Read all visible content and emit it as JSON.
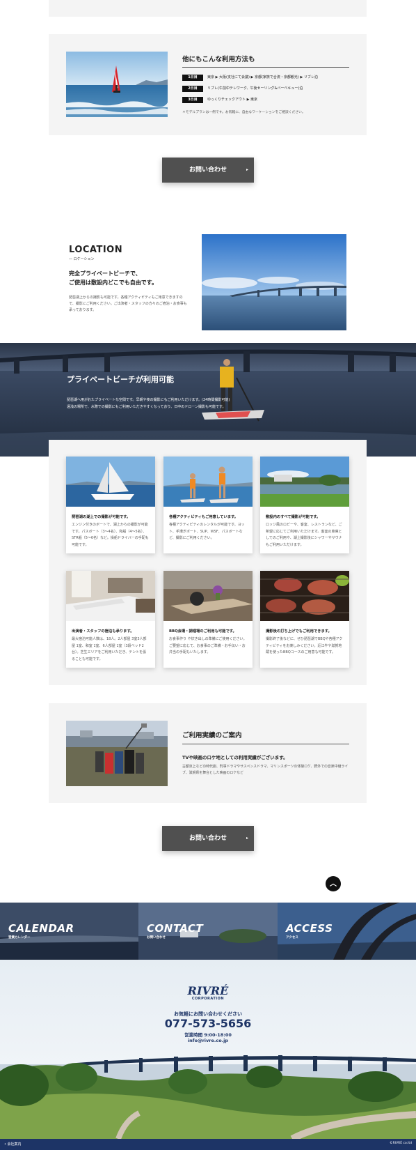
{
  "usage_box": {
    "title": "他にもこんな利用方法も",
    "days": [
      {
        "tag": "1日目",
        "text": "東京 ▶ 大阪(支社にて会議) ▶ 京都(家族で合流・京都観光) ▶ リブレ泊"
      },
      {
        "tag": "2日目",
        "text": "リブレ(午前中テレワーク、午後セーリング&バーベキュー)泊"
      },
      {
        "tag": "3日目",
        "text": "ゆっくりチェックアウト ▶ 東京"
      }
    ],
    "note": "＊モデルプランは一例です。お気軽に、自由なワーケーションをご相談ください。"
  },
  "cta": {
    "label": "お問い合わせ",
    "arrow": "▸"
  },
  "location": {
    "heading": "LOCATION",
    "subheading": "― ロケーション",
    "lead_line1": "完全プライベートビーチで、",
    "lead_line2": "ご使用は敷設内どこでも自由です。",
    "body": "琵琶湖上からの撮影も可能です。各種アクティビティもご用意できますので、撮影にご利用ください。ご出演者・スタッフの方々のご宿泊・お食事も承っております。"
  },
  "banner": {
    "title": "プライベートビーチが利用可能",
    "line1": "琵琶湖へ用がおたプライベートな空間です。早朝や夜の撮影にもご利用いただけます。(24時間撮影可能)",
    "line2": "遠浅の場所で、水際での撮影にもご利用いただきやすくなっており、日中のドローン撮影も可能です。"
  },
  "features": [
    {
      "title": "琵琶湖の湖上での撮影が可能です。",
      "text": "エンジン付きのボートで、湖上からの撮影が可能です。パスボート（3〜4名）、和船（4〜5名）、STR船（5〜6名）など。操船ドライバーの手配も可能です。"
    },
    {
      "title": "各種アクティビティもご用意しています。",
      "text": "各種アクティビティのレンタルが可能です。ヨット、手漕ぎボート、SUP、WSF、パスボートなど、撮影にご利用ください。"
    },
    {
      "title": "敷設内のすべて撮影が可能です。",
      "text": "ロッジ風のロビーや、客室、レストランなど、ご希望に応じてご利用いただけます。客室の車庫としてのご利用や、湖上撮影後にシャワーやサウナもご利用いただけます。"
    },
    {
      "title": "出演者・スタッフの宿泊も承ります。",
      "text": "最大宿泊可能人数は、18人。2人部屋 3室3人部屋 1室、和室 1室、6人部屋 1室（3段ベッド2台）。芝生エリアをご利用いただき、テントを張ることも可能です。"
    },
    {
      "title": "BBQ会場・調理場のご利用も可能です。",
      "text": "お食事作り や炊き出しの準備にご使用ください。ご要望に応じて、お食事のご準備・お手伝い・お弁当の手配もいたします。"
    },
    {
      "title": "撮影後の打ち上げでもご利用できます。",
      "text": "撮影終了後などに、ぜひ琵琶湖でBBQや各種アクティビティをお楽しみください。近江牛や滋賀地蔵を使ったBBQコースのご用意も可能です。"
    }
  ],
  "record": {
    "title": "ご利用実績のご案内",
    "lead": "TVや映画のロケ地としての利用実績がございます。",
    "body": "古都京上などの時代劇、刑事ドラマやサスペンスドラマ、マリンスポーツの体験ロケ、野外での音楽中継ライブ、滋賀県を舞台とした映画のロケなど"
  },
  "pagetop": {
    "icon": "chevron-up-icon",
    "glyph": "︿"
  },
  "tiles": [
    {
      "label": "CALENDAR",
      "sub": "営業カレンダー"
    },
    {
      "label": "CONTACT",
      "sub": "お問い合わせ"
    },
    {
      "label": "ACCESS",
      "sub": "アクセス"
    }
  ],
  "footer": {
    "logo": "RIVRÉ",
    "logo_sub": "CORPORATION",
    "call_lead": "お気軽にお問い合わせください",
    "phone": "077-573-5656",
    "hours": "営業時間 9:00-18:00",
    "email": "info@rivre.co.jp",
    "bottom_link": "会社案内",
    "copyright": "©RIVRÉ co.ltd"
  },
  "colors": {
    "accent": "#1d3466",
    "cta": "#505050",
    "gray_box": "#f4f4f4"
  }
}
